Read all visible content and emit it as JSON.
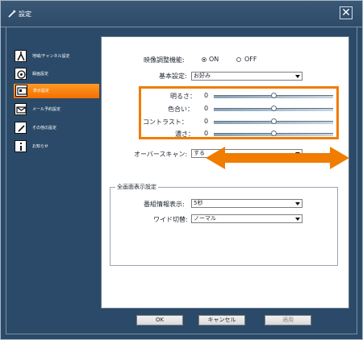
{
  "window": {
    "title": "設定",
    "close_label": "✕"
  },
  "sidebar": {
    "items": [
      {
        "label": "地域/チャンネル設定",
        "icon": "antenna-icon",
        "active": false
      },
      {
        "label": "録画設定",
        "icon": "record-icon",
        "active": false
      },
      {
        "label": "表示設定",
        "icon": "display-icon",
        "active": true
      },
      {
        "label": "メール予約設定",
        "icon": "mail-icon",
        "active": false
      },
      {
        "label": "その他の設定",
        "icon": "wrench-icon",
        "active": false
      },
      {
        "label": "お知らせ",
        "icon": "info-icon",
        "active": false
      }
    ]
  },
  "settings": {
    "video_adjust_label": "映像調整機能:",
    "on_label": "ON",
    "off_label": "OFF",
    "selected": "ON",
    "basic_label": "基本設定:",
    "basic_value": "お好み",
    "sliders": [
      {
        "label": "明るさ：",
        "value": "0",
        "level": 0.5
      },
      {
        "label": "色合い：",
        "value": "0",
        "level": 0.5
      },
      {
        "label": "コントラスト：",
        "value": "0",
        "level": 0.5
      },
      {
        "label": "濃さ：",
        "value": "0",
        "level": 0.5
      }
    ],
    "overscan_label": "オーバースキャン:",
    "overscan_value": "する"
  },
  "fullscreen": {
    "group_title": "全画面表示設定",
    "program_info_label": "番組情報表示:",
    "program_info_value": "5秒",
    "wide_label": "ワイド切替:",
    "wide_value": "ノーマル"
  },
  "buttons": {
    "ok": "OK",
    "cancel": "キャンセル",
    "apply": "適用"
  },
  "colors": {
    "accent": "#f07c00",
    "background": "#2f4b66"
  }
}
